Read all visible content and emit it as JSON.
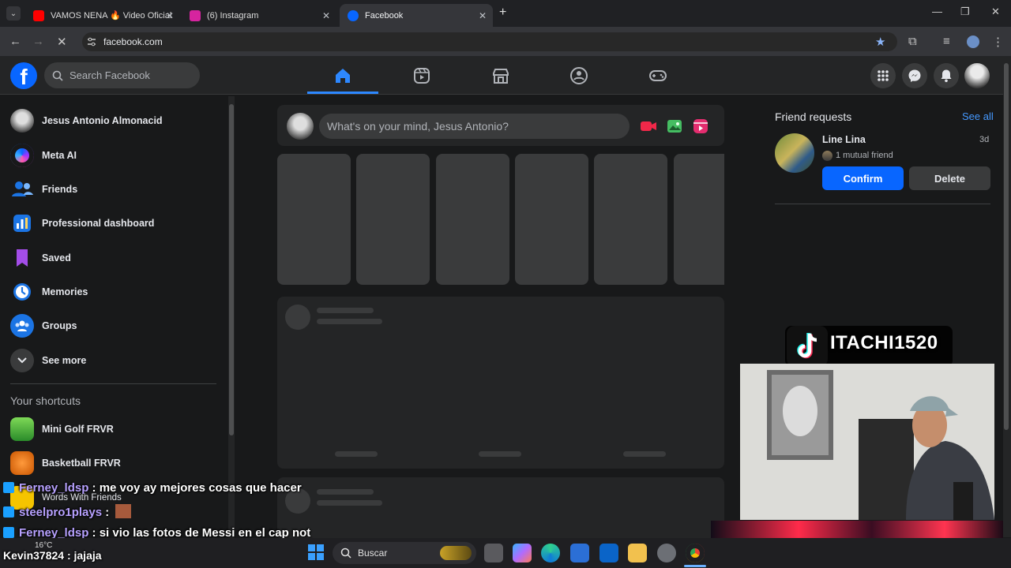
{
  "browser": {
    "tabs": [
      {
        "title": "VAMOS NENA 🔥 Video Oficial",
        "icon": "youtube-icon",
        "color": "#ff0000"
      },
      {
        "title": "(6) Instagram",
        "icon": "instagram-icon",
        "color": "#d6249f"
      },
      {
        "title": "Facebook",
        "icon": "facebook-icon",
        "color": "#0866ff",
        "active": true
      }
    ],
    "url": "facebook.com",
    "window_controls": [
      "—",
      "❐",
      "✕"
    ]
  },
  "fb": {
    "search_placeholder": "Search Facebook",
    "nav": [
      "home-icon",
      "reels-icon",
      "marketplace-icon",
      "groups-icon",
      "gaming-icon"
    ],
    "sidebar": [
      {
        "label": "Jesus Antonio Almonacid",
        "icon": "profile-avatar"
      },
      {
        "label": "Meta AI",
        "icon": "meta-ai-icon"
      },
      {
        "label": "Friends",
        "icon": "friends-icon"
      },
      {
        "label": "Professional dashboard",
        "icon": "dashboard-icon"
      },
      {
        "label": "Saved",
        "icon": "saved-icon"
      },
      {
        "label": "Memories",
        "icon": "memories-icon"
      },
      {
        "label": "Groups",
        "icon": "groups-icon"
      },
      {
        "label": "See more",
        "icon": "chevron-down-icon"
      }
    ],
    "shortcuts_title": "Your shortcuts",
    "shortcuts": [
      "Mini Golf FRVR",
      "Basketball FRVR",
      "Words With Friends"
    ],
    "composer_placeholder": "What's on your mind, Jesus Antonio?",
    "friend_requests": {
      "title": "Friend requests",
      "see_all": "See all",
      "name": "Line Lina",
      "time": "3d",
      "mutual": "1 mutual friend",
      "confirm": "Confirm",
      "delete": "Delete"
    }
  },
  "stream": {
    "tiktok_name": "ITACHI1520",
    "chat": [
      {
        "user": "Ferney_ldsp",
        "msg": " : me voy ay mejores cosas que hacer"
      },
      {
        "user": "steelpro1plays",
        "msg": " : "
      },
      {
        "user": "Ferney_ldsp",
        "msg": " : si vio las fotos de Messi en el cap not"
      },
      {
        "user": "Kevin37824",
        "msg": " : jajaja"
      }
    ]
  },
  "taskbar": {
    "search": "Buscar",
    "weather": "16°C"
  }
}
